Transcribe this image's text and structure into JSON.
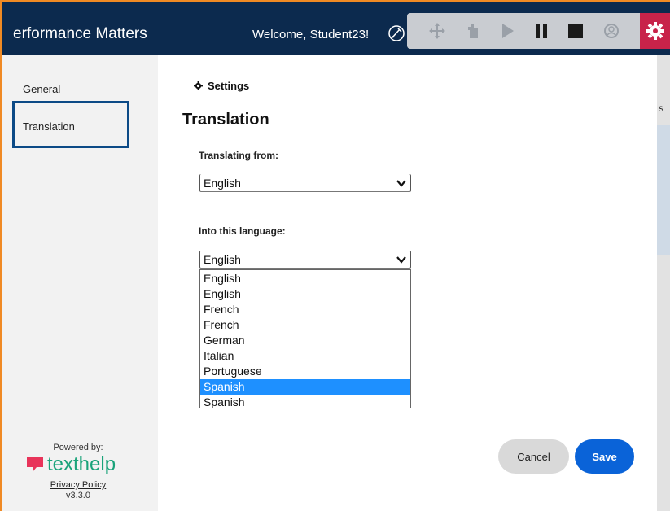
{
  "header": {
    "brand": "erformance Matters",
    "welcome": "Welcome, Student23!"
  },
  "toolbar": {
    "icons": [
      "move-icon",
      "hand-icon",
      "play-icon",
      "pause-icon",
      "stop-icon",
      "screen-mask-icon",
      "gear-icon"
    ],
    "accent": "#c8234a"
  },
  "sidebar": {
    "items": [
      {
        "label": "General"
      },
      {
        "label": "Translation"
      }
    ],
    "powered_by": "Powered by:",
    "logo": "texthelp",
    "privacy": "Privacy Policy",
    "version": "v3.3.0"
  },
  "main": {
    "settings_title": "Settings",
    "heading": "Translation",
    "from_label": "Translating from:",
    "from_value": "English",
    "into_label": "Into this language:",
    "into_value": "English",
    "options": [
      "English",
      "English",
      "French",
      "French",
      "German",
      "Italian",
      "Portuguese",
      "Spanish",
      "Spanish"
    ],
    "highlighted_option": "Spanish"
  },
  "buttons": {
    "cancel": "Cancel",
    "save": "Save"
  },
  "underlay": {
    "text": "s"
  },
  "colors": {
    "header_bg": "#0c2a4e",
    "frame": "#f08a24",
    "primary": "#0a63d8",
    "highlight": "#1e90ff"
  }
}
